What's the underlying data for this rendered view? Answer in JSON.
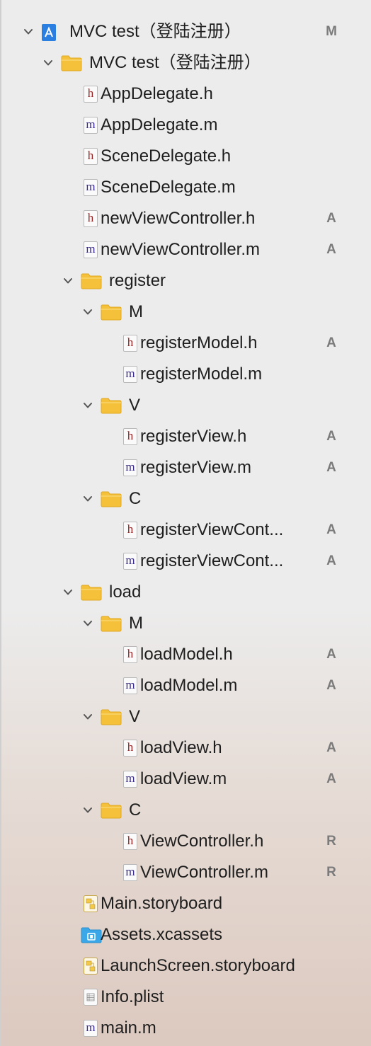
{
  "tree": [
    {
      "id": "project",
      "depth": 0,
      "chevron": true,
      "icon": "xcodeproj-icon",
      "label": "MVC test（登陆注册）",
      "badge": "M"
    },
    {
      "id": "group-main",
      "depth": 1,
      "chevron": true,
      "icon": "folder-icon",
      "label": "MVC test（登陆注册）",
      "badge": ""
    },
    {
      "id": "appdelegate-h",
      "depth": 2,
      "chevron": false,
      "icon": "h-file-icon",
      "label": "AppDelegate.h",
      "badge": ""
    },
    {
      "id": "appdelegate-m",
      "depth": 2,
      "chevron": false,
      "icon": "m-file-icon",
      "label": "AppDelegate.m",
      "badge": ""
    },
    {
      "id": "scenedelegate-h",
      "depth": 2,
      "chevron": false,
      "icon": "h-file-icon",
      "label": "SceneDelegate.h",
      "badge": ""
    },
    {
      "id": "scenedelegate-m",
      "depth": 2,
      "chevron": false,
      "icon": "m-file-icon",
      "label": "SceneDelegate.m",
      "badge": ""
    },
    {
      "id": "newviewcontroller-h",
      "depth": 2,
      "chevron": false,
      "icon": "h-file-icon",
      "label": "newViewController.h",
      "badge": "A"
    },
    {
      "id": "newviewcontroller-m",
      "depth": 2,
      "chevron": false,
      "icon": "m-file-icon",
      "label": "newViewController.m",
      "badge": "A"
    },
    {
      "id": "group-register",
      "depth": 2,
      "chevron": true,
      "icon": "folder-icon",
      "label": "register",
      "badge": ""
    },
    {
      "id": "register-m-folder",
      "depth": 3,
      "chevron": true,
      "icon": "folder-icon",
      "label": "M",
      "badge": ""
    },
    {
      "id": "registermodel-h",
      "depth": 4,
      "chevron": false,
      "icon": "h-file-icon",
      "label": "registerModel.h",
      "badge": "A"
    },
    {
      "id": "registermodel-m",
      "depth": 4,
      "chevron": false,
      "icon": "m-file-icon",
      "label": "registerModel.m",
      "badge": ""
    },
    {
      "id": "register-v-folder",
      "depth": 3,
      "chevron": true,
      "icon": "folder-icon",
      "label": "V",
      "badge": ""
    },
    {
      "id": "registerview-h",
      "depth": 4,
      "chevron": false,
      "icon": "h-file-icon",
      "label": "registerView.h",
      "badge": "A"
    },
    {
      "id": "registerview-m",
      "depth": 4,
      "chevron": false,
      "icon": "m-file-icon",
      "label": "registerView.m",
      "badge": "A"
    },
    {
      "id": "register-c-folder",
      "depth": 3,
      "chevron": true,
      "icon": "folder-icon",
      "label": "C",
      "badge": ""
    },
    {
      "id": "registerviewcont-h",
      "depth": 4,
      "chevron": false,
      "icon": "h-file-icon",
      "label": "registerViewCont...",
      "badge": "A"
    },
    {
      "id": "registerviewcont-m",
      "depth": 4,
      "chevron": false,
      "icon": "m-file-icon",
      "label": "registerViewCont...",
      "badge": "A"
    },
    {
      "id": "group-load",
      "depth": 2,
      "chevron": true,
      "icon": "folder-icon",
      "label": "load",
      "badge": ""
    },
    {
      "id": "load-m-folder",
      "depth": 3,
      "chevron": true,
      "icon": "folder-icon",
      "label": "M",
      "badge": ""
    },
    {
      "id": "loadmodel-h",
      "depth": 4,
      "chevron": false,
      "icon": "h-file-icon",
      "label": "loadModel.h",
      "badge": "A"
    },
    {
      "id": "loadmodel-m",
      "depth": 4,
      "chevron": false,
      "icon": "m-file-icon",
      "label": "loadModel.m",
      "badge": "A"
    },
    {
      "id": "load-v-folder",
      "depth": 3,
      "chevron": true,
      "icon": "folder-icon",
      "label": "V",
      "badge": ""
    },
    {
      "id": "loadview-h",
      "depth": 4,
      "chevron": false,
      "icon": "h-file-icon",
      "label": "loadView.h",
      "badge": "A"
    },
    {
      "id": "loadview-m",
      "depth": 4,
      "chevron": false,
      "icon": "m-file-icon",
      "label": "loadView.m",
      "badge": "A"
    },
    {
      "id": "load-c-folder",
      "depth": 3,
      "chevron": true,
      "icon": "folder-icon",
      "label": "C",
      "badge": ""
    },
    {
      "id": "viewcontroller-h",
      "depth": 4,
      "chevron": false,
      "icon": "h-file-icon",
      "label": "ViewController.h",
      "badge": "R"
    },
    {
      "id": "viewcontroller-m",
      "depth": 4,
      "chevron": false,
      "icon": "m-file-icon",
      "label": "ViewController.m",
      "badge": "R"
    },
    {
      "id": "main-storyboard",
      "depth": 2,
      "chevron": false,
      "icon": "storyboard-icon",
      "label": "Main.storyboard",
      "badge": ""
    },
    {
      "id": "assets-xcassets",
      "depth": 2,
      "chevron": false,
      "icon": "asset-catalog-icon",
      "label": "Assets.xcassets",
      "badge": ""
    },
    {
      "id": "launchscreen-storyboard",
      "depth": 2,
      "chevron": false,
      "icon": "storyboard-icon",
      "label": "LaunchScreen.storyboard",
      "badge": ""
    },
    {
      "id": "info-plist",
      "depth": 2,
      "chevron": false,
      "icon": "plist-icon",
      "label": "Info.plist",
      "badge": ""
    },
    {
      "id": "main-m",
      "depth": 2,
      "chevron": false,
      "icon": "m-file-icon",
      "label": "main.m",
      "badge": ""
    }
  ],
  "colors": {
    "h_letter": "#9c2323",
    "m_letter": "#3a2c8a",
    "folder": "#f5c13a",
    "project_icon": "#2b7fe0",
    "badge": "#7b7b7b"
  }
}
